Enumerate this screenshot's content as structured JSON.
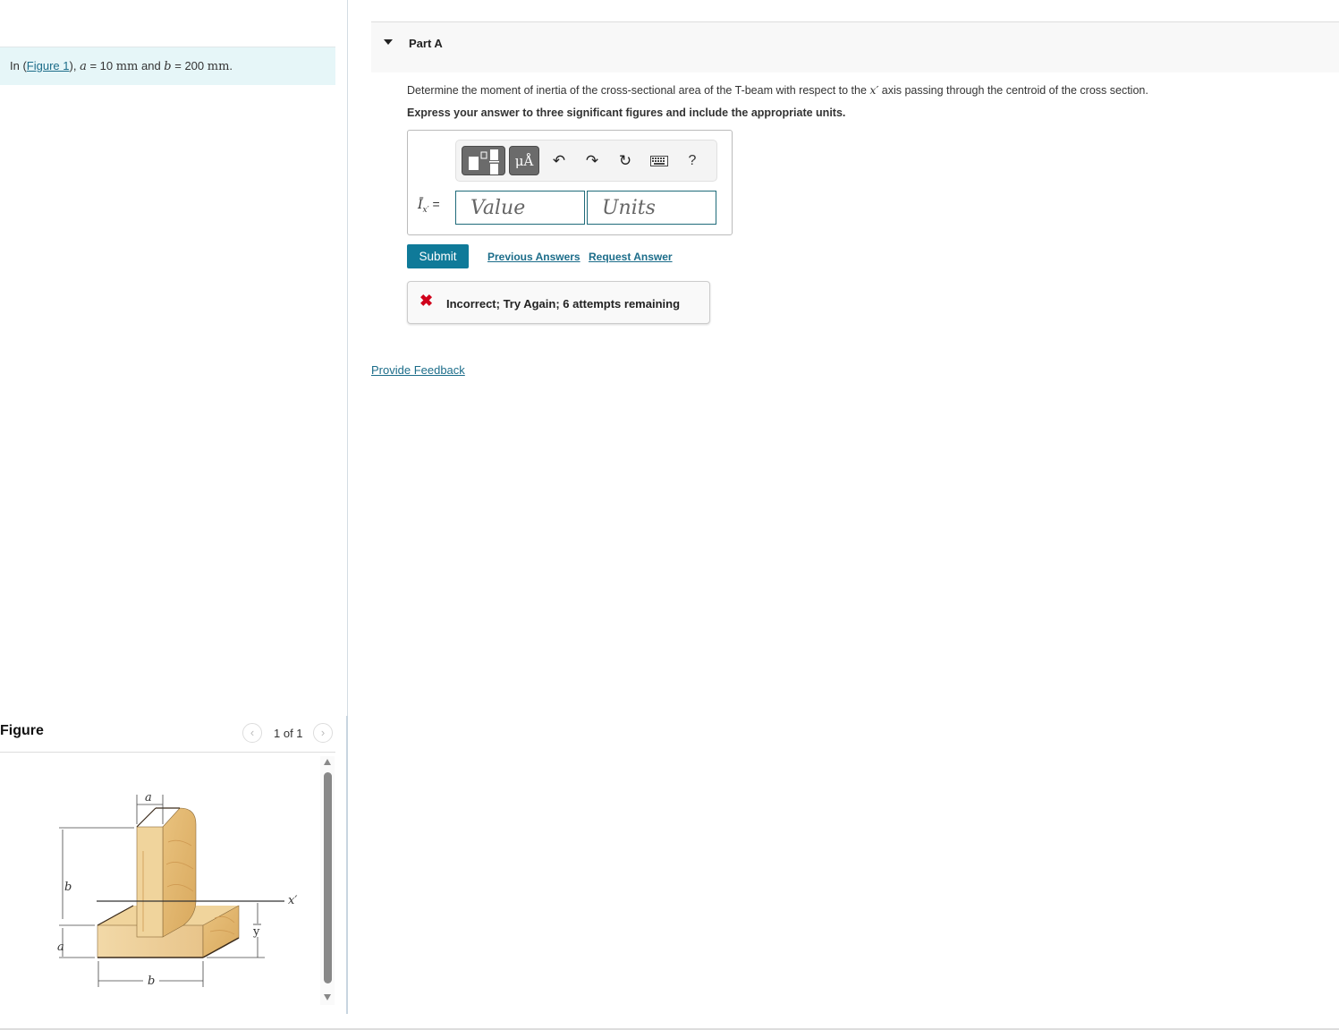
{
  "intro": {
    "prefix": "In (",
    "figure_link": "Figure 1",
    "suffix": "), ",
    "var_a": "a",
    "eq_a": " = 10 ",
    "unit_a": "mm",
    "and": " and ",
    "var_b": "b",
    "eq_b": " = 200 ",
    "unit_b": "mm",
    "end": "."
  },
  "figure_panel": {
    "title": "Figure",
    "pager_text": "1 of 1",
    "prev_icon": "‹",
    "next_icon": "›",
    "labels": {
      "a_top": "a",
      "b_left": "b",
      "a_left": "a",
      "b_bottom": "b",
      "x_prime": "x′",
      "y_bar": "y"
    }
  },
  "part": {
    "title": "Part A",
    "question_pre": "Determine the moment of inertia of the cross-sectional area of the T-beam with respect to the ",
    "question_var": "x′",
    "question_post": " axis passing through the centroid of the cross section.",
    "instruction": "Express your answer to three significant figures and include the appropriate units."
  },
  "answer": {
    "toolbar": {
      "units_label": "μÅ",
      "undo_icon": "↶",
      "redo_icon": "↷",
      "reset_icon": "↻",
      "help_label": "?"
    },
    "var_symbol": "Ī",
    "var_sub": "x′",
    "equals": " =",
    "value_placeholder": "Value",
    "units_placeholder": "Units"
  },
  "actions": {
    "submit": "Submit",
    "previous_answers": "Previous Answers",
    "request_answer": "Request Answer"
  },
  "feedback": {
    "icon": "✖",
    "message": "Incorrect; Try Again; 6 attempts remaining",
    "color": "#d0021b"
  },
  "provide_feedback": "Provide Feedback"
}
